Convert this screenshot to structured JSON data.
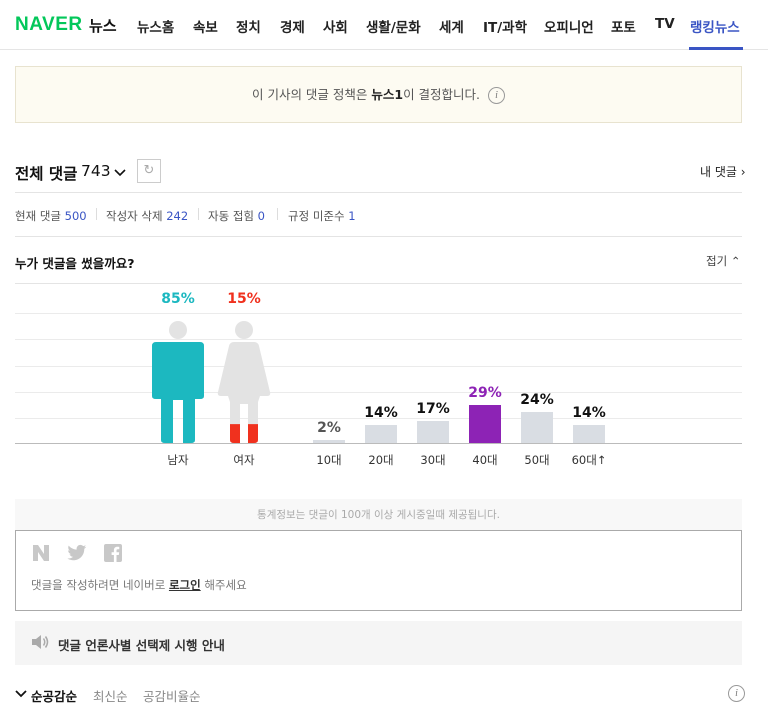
{
  "nav": {
    "logo": "NAVER",
    "section": "뉴스",
    "items": [
      "뉴스홈",
      "속보",
      "정치",
      "경제",
      "사회",
      "생활/문화",
      "세계",
      "IT/과학",
      "오피니언",
      "포토",
      "TV",
      "랭킹뉴스"
    ],
    "active_item": "랭킹뉴스"
  },
  "banner": {
    "prefix": "이 기사의 댓글 정책은 ",
    "press": "뉴스1",
    "suffix": "이 결정합니다.",
    "info_icon": "i"
  },
  "comments": {
    "title": "전체 댓글",
    "count": "743",
    "refresh_icon": "↻",
    "my_comments": "내 댓글 ›",
    "stats": {
      "current_label": "현재 댓글",
      "current_value": "500",
      "deleted_label": "작성자 삭제",
      "deleted_value": "242",
      "auto_label": "자동 접힘",
      "auto_value": "0",
      "violation_label": "규정 미준수",
      "violation_value": "1"
    }
  },
  "who": {
    "title": "누가 댓글을 썼을까요?",
    "collapse": "접기 ⌃"
  },
  "chart_data": {
    "type": "bar",
    "gender": {
      "categories": [
        "남자",
        "여자"
      ],
      "values": [
        85,
        15
      ],
      "labels": [
        "85%",
        "15%"
      ],
      "colors": [
        "#1cb8c0",
        "#f0311e"
      ]
    },
    "age": {
      "categories": [
        "10대",
        "20대",
        "30대",
        "40대",
        "50대",
        "60대↑"
      ],
      "values": [
        2,
        14,
        17,
        29,
        24,
        14
      ],
      "labels": [
        "2%",
        "14%",
        "17%",
        "29%",
        "24%",
        "14%"
      ],
      "highlight_index": 3,
      "highlight_color": "#8d23b5",
      "bar_color": "#d9dde3"
    }
  },
  "footnote": "통계정보는 댓글이 100개 이상 게시중일때 제공됩니다.",
  "login": {
    "social": [
      "naver-icon",
      "twitter-icon",
      "facebook-icon"
    ],
    "social_glyphs": [
      "N",
      "t",
      "f"
    ],
    "prefix": "댓글을 작성하려면 네이버로 ",
    "link": "로그인",
    "suffix": " 해주세요"
  },
  "notice": {
    "text": "댓글 언론사별 선택제 시행 안내"
  },
  "sort": {
    "check": "✓",
    "items": [
      "순공감순",
      "최신순",
      "공감비율순"
    ],
    "active": "순공감순"
  }
}
